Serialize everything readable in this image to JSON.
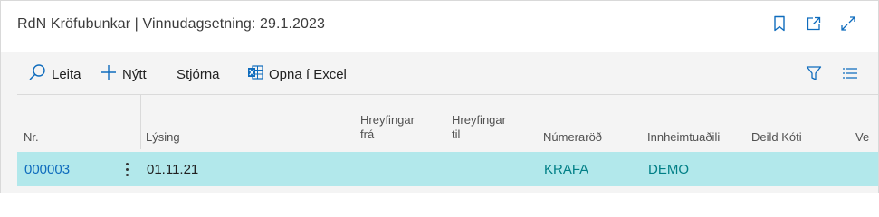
{
  "page": {
    "title": "RdN Kröfubunkar | Vinnudagsetning: 29.1.2023"
  },
  "title_actions": {
    "bookmark_icon": "bookmark-icon",
    "popout_icon": "open-in-new-window-icon",
    "expand_icon": "expand-icon"
  },
  "toolbar": {
    "search_label": "Leita",
    "new_label": "Nýtt",
    "manage_label": "Stjórna",
    "excel_label": "Opna í Excel",
    "filter_icon": "filter-icon",
    "list_icon": "list-view-icon"
  },
  "table": {
    "headers": {
      "nr": "Nr.",
      "lysing": "Lýsing",
      "hreyf_fra_1": "Hreyfingar",
      "hreyf_fra_2": "frá",
      "hreyf_til_1": "Hreyfingar",
      "hreyf_til_2": "til",
      "numerarod": "Númeraröð",
      "innheimtuadili": "Innheimtuaðili",
      "deild_koti": "Deild Kóti",
      "ve": "Ve"
    },
    "rows": [
      {
        "nr": "000003",
        "lysing": "01.11.21",
        "hreyf_fra": "",
        "hreyf_til": "",
        "numerarod": "KRAFA",
        "innheimtuadili": "DEMO",
        "deild_koti": ""
      }
    ]
  },
  "colors": {
    "selected_row": "#b2e8eb",
    "link": "#0f6cbd",
    "accent_teal": "#007f86",
    "toolbar_bg": "#f4f4f4"
  }
}
